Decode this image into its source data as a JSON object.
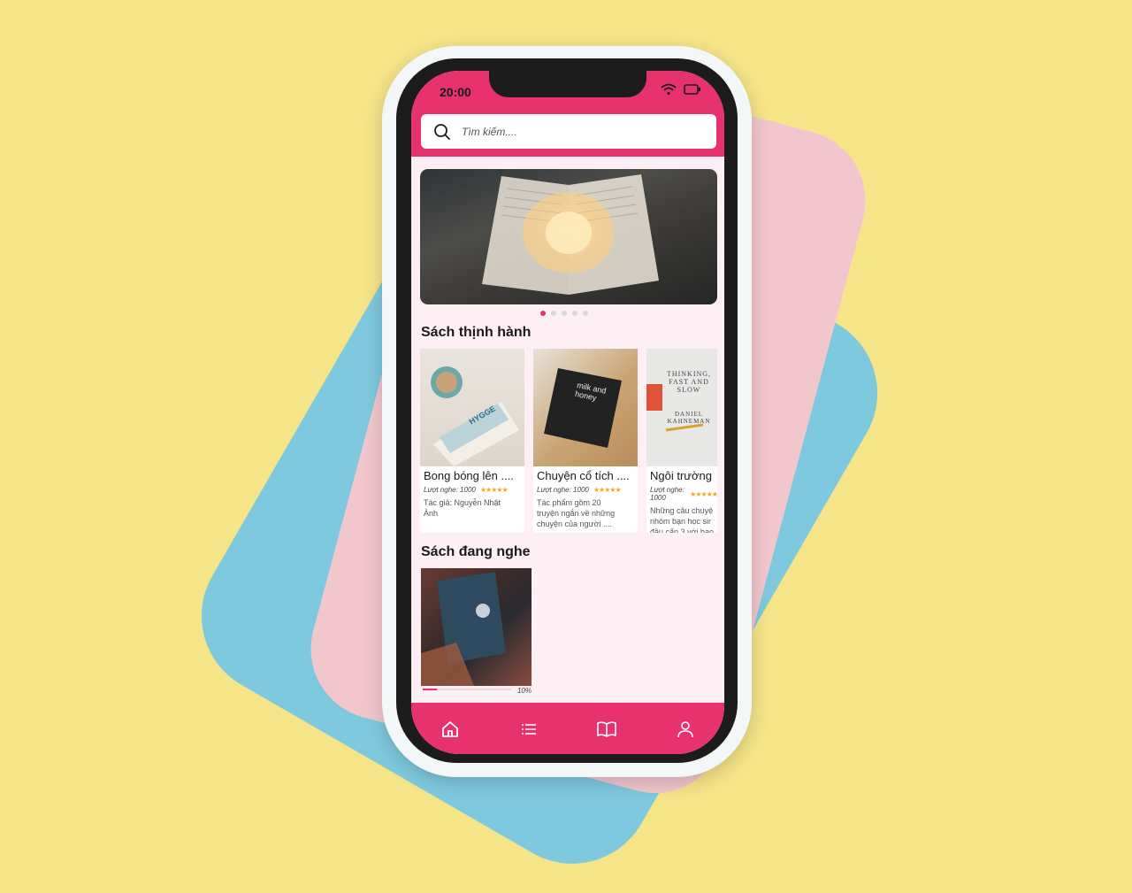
{
  "status": {
    "time": "20:00"
  },
  "search": {
    "placeholder": "Tìm kiếm...."
  },
  "banner": {
    "dots": 5,
    "active_index": 0
  },
  "sections": {
    "trending": "Sách thịnh hành",
    "listening": "Sách đang nghe"
  },
  "trending_books": [
    {
      "title": "Bong bóng lên ....",
      "views": "Lượt nghe: 1000",
      "rating": 5,
      "desc": "Tác giả: Nguyễn Nhật\nÁnh"
    },
    {
      "title": "Chuyện cổ tích ....",
      "views": "Lượt nghe: 1000",
      "rating": 5,
      "desc": "Tác phẩm gồm 20\ntruyện ngắn về những\nchuyện của người ...."
    },
    {
      "title": "Ngôi trường",
      "views": "Lượt nghe: 1000",
      "rating": 5,
      "desc": "Những câu chuyệ\nnhóm bạn học sir\nđầu cấp 3 với bao"
    }
  ],
  "cover_texts": {
    "book1": "HYGGE",
    "book2": "milk and honey",
    "book3_title": "THINKING, FAST AND SLOW",
    "book3_author": "DANIEL KAHNEMAN"
  },
  "listening": {
    "progress_label": "10%",
    "progress": 0.1
  },
  "nav": [
    "home-icon",
    "list-icon",
    "book-icon",
    "user-icon"
  ],
  "colors": {
    "primary": "#e7326e",
    "background": "#fdeff3",
    "star": "#f2a71b"
  }
}
